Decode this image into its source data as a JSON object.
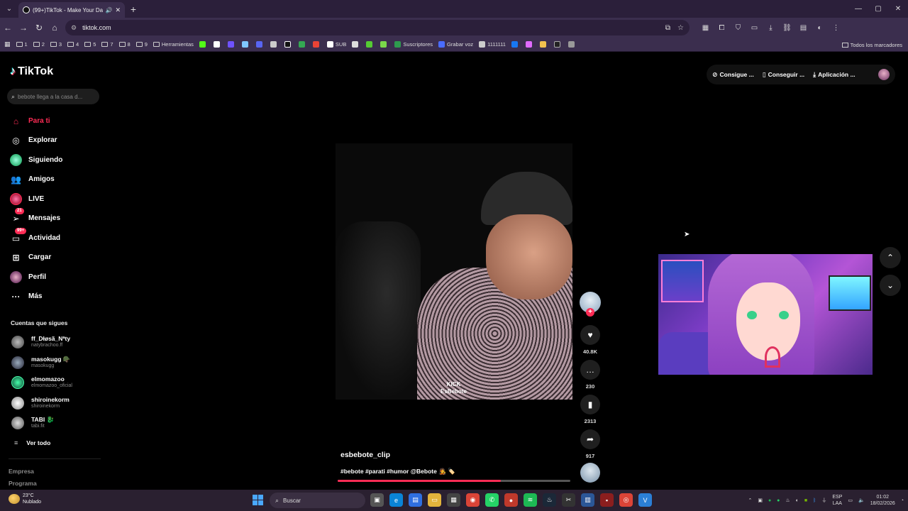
{
  "browser": {
    "tab_title": "(99+)TikTok - Make Your Da",
    "url": "tiktok.com",
    "bookmarks": [
      "1",
      "2",
      "3",
      "4",
      "5",
      "7",
      "8",
      "9",
      "Herramientas"
    ],
    "bookmark_labels": {
      "sub": "SUB",
      "suscriptores": "Suscriptores",
      "grabar_voz": "Grabar voz",
      "numbers": "1111111"
    },
    "all_bookmarks": "Todos los marcadores"
  },
  "tiktok": {
    "logo": "TikTok",
    "search_placeholder": "bebote llega a la casa d...",
    "nav": [
      "Para ti",
      "Explorar",
      "Siguiendo",
      "Amigos",
      "LIVE",
      "Mensajes",
      "Actividad",
      "Cargar",
      "Perfil",
      "Más"
    ],
    "badges": {
      "messages": "21",
      "activity": "99+"
    },
    "following_title": "Cuentas que sigues",
    "following": [
      {
        "name": "ff_Dłøsã_Nªty",
        "handle": "natybrachoo.ff"
      },
      {
        "name": "masokugg 🪖",
        "handle": "masokugg"
      },
      {
        "name": "elmomazoo",
        "handle": "elmomazoo_oficial"
      },
      {
        "name": "shiroinekorm",
        "handle": "shiroinekorm"
      },
      {
        "name": "TABI 🐉",
        "handle": "tabi.fit"
      }
    ],
    "view_all": "Ver todo",
    "footer": [
      "Empresa",
      "Programa"
    ],
    "top_actions": [
      "Consigue ...",
      "Conseguir ...",
      "Aplicación ..."
    ],
    "video": {
      "watermark_line1": "KICK",
      "watermark_line2": "EsBebote",
      "author": "esbebote_clip",
      "description": "#bebote #parati #humor @Bebote 🧑‍🎤 🏷️",
      "likes": "40.8K",
      "comments": "230",
      "saves": "2313",
      "shares": "917",
      "progress_fraction": 0.7
    }
  },
  "taskbar": {
    "temp": "23°C",
    "condition": "Nublado",
    "search": "Buscar",
    "lang1": "ESP",
    "lang2": "LAA",
    "time": "01:02",
    "date": "18/02/2026"
  }
}
